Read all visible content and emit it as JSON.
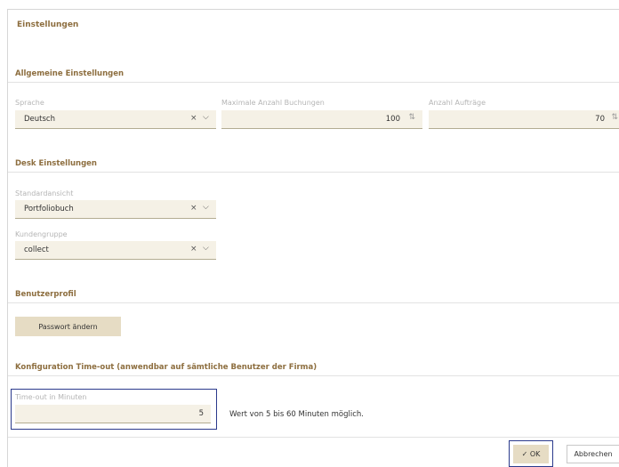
{
  "dialog": {
    "title": "Einstellungen"
  },
  "general": {
    "heading": "Allgemeine Einstellungen",
    "language": {
      "label": "Sprache",
      "value": "Deutsch"
    },
    "max_bookings": {
      "label": "Maximale Anzahl Buchungen",
      "value": "100"
    },
    "order_count": {
      "label": "Anzahl Aufträge",
      "value": "70"
    }
  },
  "desk": {
    "heading": "Desk Einstellungen",
    "default_view": {
      "label": "Standardansicht",
      "value": "Portfoliobuch"
    },
    "customer_group": {
      "label": "Kundengruppe",
      "value": "collect"
    }
  },
  "profile": {
    "heading": "Benutzerprofil",
    "change_password_label": "Passwort ändern"
  },
  "timeout": {
    "heading": "Konfiguration Time-out (anwendbar auf sämtliche Benutzer der Firma)",
    "label": "Time-out in Minuten",
    "value": "5",
    "hint": "Wert von 5 bis 60 Minuten möglich."
  },
  "footer": {
    "ok_label": "OK",
    "cancel_label": "Abbrechen"
  },
  "icons": {
    "clear": "×",
    "chevron": "⌵",
    "spinner": "⇅",
    "check": "✓"
  },
  "colors": {
    "accent": "#8d6e3f",
    "field_bg": "#f5f1e6",
    "button_bg": "#e6dcc4",
    "focus": "#2b3a8c"
  }
}
